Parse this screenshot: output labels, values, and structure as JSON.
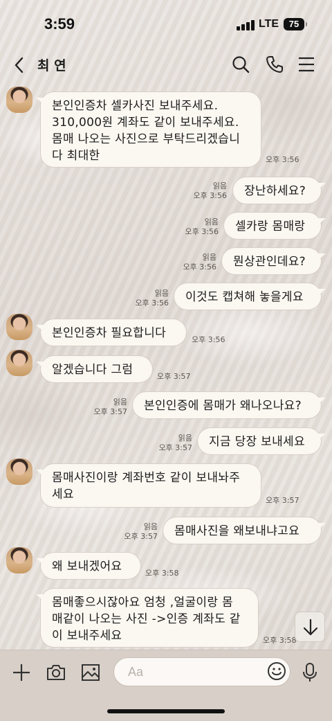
{
  "status_bar": {
    "time": "3:59",
    "network": "LTE",
    "battery": "75"
  },
  "header": {
    "contact_name": "최 연"
  },
  "messages": [
    {
      "text": "본인인증차 셀카사진 보내주세요.\n310,000원 계좌도 같이 보내주세요.\n몸매 나오는 사진으로 부탁드리겠습니\n다 최대한",
      "time": "오후 3:56"
    },
    {
      "text": "장난하세요?",
      "read": "읽음",
      "time": "오후 3:56"
    },
    {
      "text": "셀카랑 몸매랑",
      "read": "읽음",
      "time": "오후 3:56"
    },
    {
      "text": "뭔상관인데요?",
      "read": "읽음",
      "time": "오후 3:56"
    },
    {
      "text": "이것도 캡쳐해 놓을게요",
      "read": "읽음",
      "time": "오후 3:56"
    },
    {
      "text": "본인인증차 필요합니다",
      "time": "오후 3:56"
    },
    {
      "text": "알겠습니다 그럼",
      "time": "오후 3:57"
    },
    {
      "text": "본인인증에 몸매가 왜나오나요?",
      "read": "읽음",
      "time": "오후 3:57"
    },
    {
      "text": "지금 당장 보내세요",
      "read": "읽음",
      "time": "오후 3:57"
    },
    {
      "text": "몸매사진이랑 계좌번호 같이 보내놔주\n세요",
      "time": "오후 3:57"
    },
    {
      "text": "몸매사진을 왜보내냐고요",
      "read": "읽음",
      "time": "오후 3:57"
    },
    {
      "text": "왜 보내겠어요",
      "time": "오후 3:58"
    },
    {
      "text": "몸매좋으시잖아요 엄청 ,얼굴이랑 몸\n매같이 나오는 사진 ->인증 계좌도 같\n이 보내주세요",
      "time": "오후 3:58"
    }
  ],
  "composer": {
    "placeholder": "Aa"
  },
  "icons": {
    "back": "chevron-left-icon",
    "search": "search-icon",
    "call": "phone-icon",
    "menu": "menu-icon",
    "add": "plus-icon",
    "camera": "camera-icon",
    "gallery": "image-icon",
    "emoji": "emoji-icon",
    "mic": "microphone-icon",
    "scroll": "arrow-down-icon"
  }
}
